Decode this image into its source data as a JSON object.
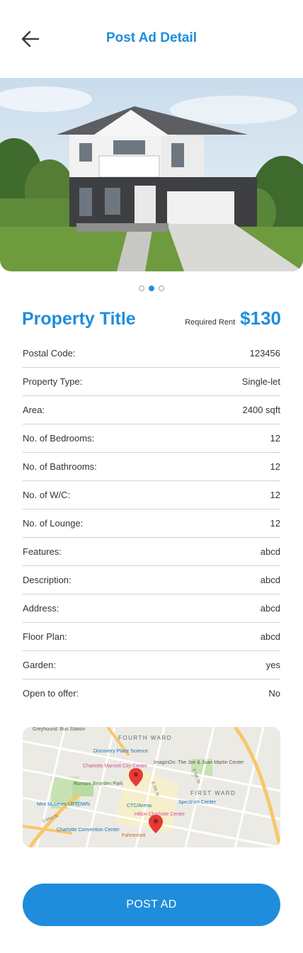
{
  "header": {
    "title": "Post Ad Detail",
    "back_icon": "arrow-left-icon"
  },
  "gallery": {
    "image": "house-photo",
    "slides": 3,
    "active_slide": 2
  },
  "property": {
    "title": "Property Title",
    "rent_label": "Required Rent",
    "rent_value": "$130"
  },
  "details": [
    {
      "label": "Postal Code:",
      "value": "123456"
    },
    {
      "label": "Property Type:",
      "value": "Single-let"
    },
    {
      "label": "Area:",
      "value": "2400 sqft"
    },
    {
      "label": "No. of Bedrooms:",
      "value": "12"
    },
    {
      "label": "No. of Bathrooms:",
      "value": "12"
    },
    {
      "label": "No. of W/C:",
      "value": "12"
    },
    {
      "label": "No. of Lounge:",
      "value": "12"
    },
    {
      "label": "Features:",
      "value": "abcd"
    },
    {
      "label": "Description:",
      "value": "abcd"
    },
    {
      "label": "Address:",
      "value": "abcd"
    },
    {
      "label": "Floor Plan:",
      "value": "abcd"
    },
    {
      "label": "Garden:",
      "value": "yes"
    },
    {
      "label": "Open to offer:",
      "value": "No"
    }
  ],
  "map": {
    "labels": {
      "greyhound": "Greyhound: Bus Station",
      "fourth_ward": "FOURTH WARD",
      "discovery": "Discovery Place Science",
      "marriott": "Charlotte Marriott City Center",
      "imaginon": "ImaginOn: The Joe & Joan Martin Center",
      "romare": "Romare Bearden Park",
      "first_ward": "FIRST WARD",
      "mint": "Mint Museum UPTOWN",
      "ctc": "CTC/Arena",
      "spectrum": "Spectrum Center",
      "hilton": "Hilton Charlotte Center",
      "convention": "Charlotte Convention Center",
      "fahrenheit": "Fahrenheit",
      "fifth": "E 5th St",
      "sixth": "E 6th St",
      "mint_st": "S Mint St"
    }
  },
  "actions": {
    "post_label": "POST AD"
  },
  "colors": {
    "accent": "#1f8ddc",
    "divider": "#d2d2d2",
    "text": "#333333"
  }
}
